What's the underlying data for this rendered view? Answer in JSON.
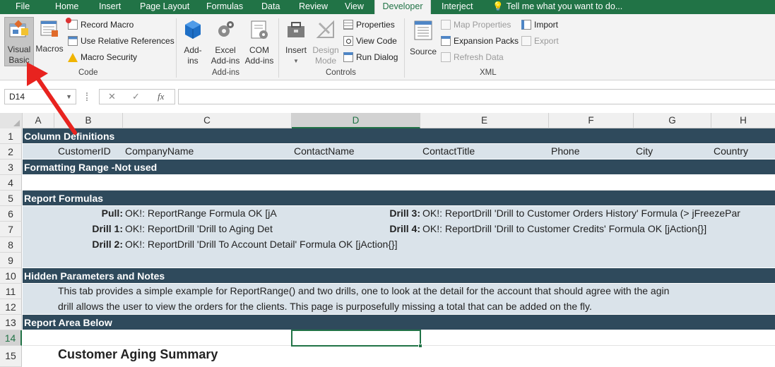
{
  "tabs": [
    "File",
    "Home",
    "Insert",
    "Page Layout",
    "Formulas",
    "Data",
    "Review",
    "View",
    "Developer",
    "Interject"
  ],
  "tell_me": "Tell me what you want to do...",
  "ribbon": {
    "visual_basic": [
      "Visual",
      "Basic"
    ],
    "macros": "Macros",
    "record_macro": "Record Macro",
    "relative_refs": "Use Relative References",
    "macro_security": "Macro Security",
    "code_group": "Code",
    "addins": [
      "Add-",
      "ins"
    ],
    "excel_addins": [
      "Excel",
      "Add-ins"
    ],
    "com_addins": [
      "COM",
      "Add-ins"
    ],
    "addins_group": "Add-ins",
    "insert": "Insert",
    "design_mode": [
      "Design",
      "Mode"
    ],
    "properties": "Properties",
    "view_code": "View Code",
    "run_dialog": "Run Dialog",
    "controls_group": "Controls",
    "source": "Source",
    "map_properties": "Map Properties",
    "expansion_packs": "Expansion Packs",
    "refresh_data": "Refresh Data",
    "import": "Import",
    "export": "Export",
    "xml_group": "XML"
  },
  "formula_bar": {
    "name_box": "D14",
    "cancel": "✕",
    "enter": "✓",
    "fx": "fx",
    "value": ""
  },
  "columns": [
    "A",
    "B",
    "C",
    "D",
    "E",
    "F",
    "G",
    "H"
  ],
  "rows": [
    "1",
    "2",
    "3",
    "4",
    "5",
    "6",
    "7",
    "8",
    "9",
    "10",
    "11",
    "12",
    "13",
    "14",
    "15"
  ],
  "sheet": {
    "r1": "Column Definitions",
    "r2": [
      "CustomerID",
      "CompanyName",
      "ContactName",
      "ContactTitle",
      "Phone",
      "City",
      "Country"
    ],
    "r3": "Formatting Range -Not used",
    "r5": "Report Formulas",
    "r6_label": "Pull:",
    "r6_value": "OK!: ReportRange Formula OK [jA",
    "r6_label2": "Drill 3:",
    "r6_value2": "OK!: ReportDrill 'Drill to Customer Orders History' Formula (> jFreezePar",
    "r7_label": "Drill 1:",
    "r7_value": "OK!: ReportDrill 'Drill to Aging Det",
    "r7_label2": "Drill 4:",
    "r7_value2": "OK!: ReportDrill 'Drill to Customer Credits' Formula OK [jAction{}]",
    "r8_label": "Drill 2:",
    "r8_value": "OK!: ReportDrill 'Drill To Account Detail' Formula OK [jAction{}]",
    "r10": "Hidden Parameters and Notes",
    "r11": "This tab provides a simple example for ReportRange() and two drills, one to look at the detail for the account that should agree with the agin",
    "r12": "drill allows the user to view the orders for the clients.   This page is purposefully missing a total that can be added on the fly.",
    "r13": "Report Area Below",
    "r15": "Customer Aging Summary"
  },
  "colors": {
    "excel_green": "#217346",
    "band_dark": "#2f4a5c",
    "band_light": "#dae3ea",
    "arrow": "#e8231f"
  }
}
